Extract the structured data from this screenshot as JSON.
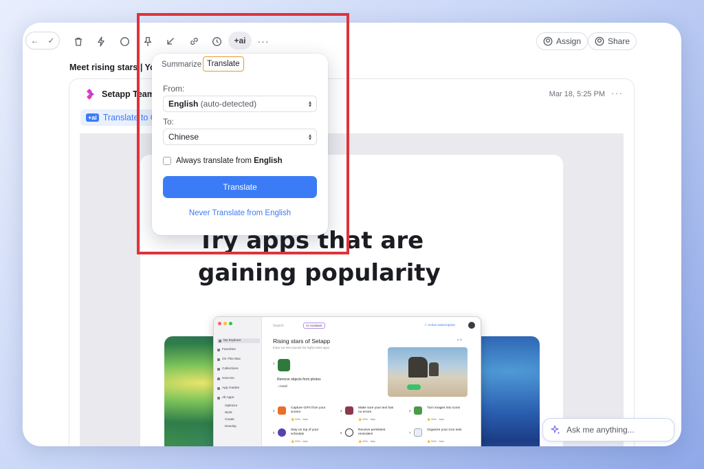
{
  "toolbar": {
    "nav_back": "←",
    "nav_check": "✓",
    "ai_label": "+ai",
    "more": "···",
    "assign_label": "Assign",
    "share_label": "Share"
  },
  "email": {
    "subject": "Meet rising stars | You",
    "sender": "Setapp Team",
    "date": "Mar 18, 5:25 PM",
    "more": "···",
    "translate_chip_badge": "+ai",
    "translate_chip_label": "Translate to C",
    "hero_line1": "Try apps that are",
    "hero_line2": "gaining popularity"
  },
  "mac_app": {
    "search": "Search",
    "ai_assistant": "AI Assistant",
    "subscription": "✓ Active subscription",
    "title": "Rising stars of Setapp",
    "desc": "Enjoy our less popular but highly-rated apps.",
    "arrows": "‹  ›",
    "sidebar": [
      "My Explorer",
      "Favorites",
      "On This Mac",
      "Collections",
      "How-tos",
      "App Guides",
      "All Apps"
    ],
    "sidebar_sub": [
      "Optimize",
      "Work",
      "Create",
      "Develop"
    ],
    "featured_num": "1",
    "featured_label": "Remove objects from photos",
    "featured_install": "↓ Install",
    "apps": [
      {
        "num": "2",
        "label1": "Capture GIFs from your",
        "label2": "screen",
        "meta": "👍 99% · Mac"
      },
      {
        "num": "3",
        "label1": "Make sure your text has",
        "label2": "no errors",
        "meta": "👍 99% · Mac"
      },
      {
        "num": "4",
        "label1": "Turn images into icons",
        "label2": "",
        "meta": "👍 99% · Mac"
      },
      {
        "num": "5",
        "label1": "Stay on top of your",
        "label2": "schedule",
        "meta": "👍 99% · Mac"
      },
      {
        "num": "6",
        "label1": "Receive persistent",
        "label2": "reminders",
        "meta": "👍 99% · Mac"
      },
      {
        "num": "7",
        "label1": "Organize your icon sets",
        "label2": "",
        "meta": "👍 99% · Mac"
      }
    ]
  },
  "popup": {
    "tab_summarize": "Summarize",
    "tab_translate": "Translate",
    "from_label": "From:",
    "from_value": "English",
    "from_hint": "(auto-detected)",
    "to_label": "To:",
    "to_value": "Chinese",
    "always_prefix": "Always translate from ",
    "always_lang": "English",
    "translate_button": "Translate",
    "never_link": "Never Translate from English"
  },
  "ask": {
    "placeholder": "Ask me anything..."
  },
  "colors": {
    "accent": "#3b7bf5",
    "highlight_border": "#e0323a",
    "active_tab_border": "#e59a2b"
  }
}
